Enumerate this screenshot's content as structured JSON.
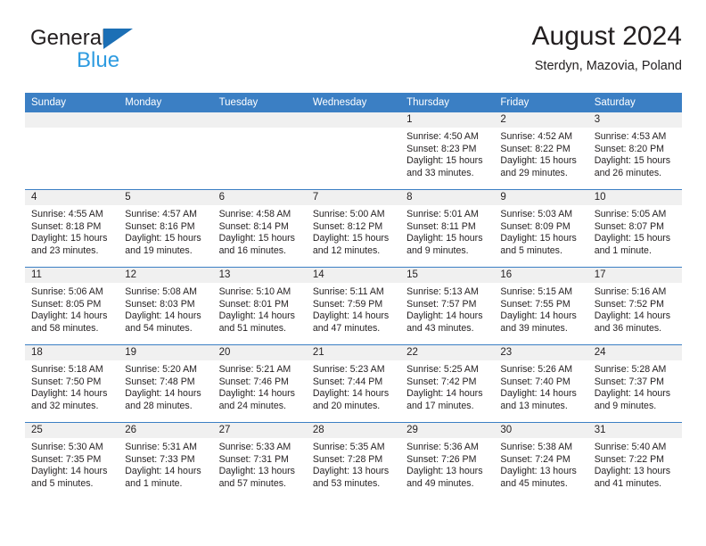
{
  "brand": {
    "name_top": "General",
    "name_bottom": "Blue",
    "triangle_color": "#1c6fb5",
    "blue_color": "#2e9be0"
  },
  "header": {
    "title": "August 2024",
    "location": "Sterdyn, Mazovia, Poland"
  },
  "colors": {
    "header_bg": "#3b7fc4",
    "header_text": "#ffffff",
    "daynum_strip": "#f0f0f0",
    "row_divider": "#3b7fc4",
    "text": "#231f20"
  },
  "weekday_headers": [
    "Sunday",
    "Monday",
    "Tuesday",
    "Wednesday",
    "Thursday",
    "Friday",
    "Saturday"
  ],
  "weeks": [
    [
      {
        "day": "",
        "info": ""
      },
      {
        "day": "",
        "info": ""
      },
      {
        "day": "",
        "info": ""
      },
      {
        "day": "",
        "info": ""
      },
      {
        "day": "1",
        "info": "Sunrise: 4:50 AM\nSunset: 8:23 PM\nDaylight: 15 hours\nand 33 minutes."
      },
      {
        "day": "2",
        "info": "Sunrise: 4:52 AM\nSunset: 8:22 PM\nDaylight: 15 hours\nand 29 minutes."
      },
      {
        "day": "3",
        "info": "Sunrise: 4:53 AM\nSunset: 8:20 PM\nDaylight: 15 hours\nand 26 minutes."
      }
    ],
    [
      {
        "day": "4",
        "info": "Sunrise: 4:55 AM\nSunset: 8:18 PM\nDaylight: 15 hours\nand 23 minutes."
      },
      {
        "day": "5",
        "info": "Sunrise: 4:57 AM\nSunset: 8:16 PM\nDaylight: 15 hours\nand 19 minutes."
      },
      {
        "day": "6",
        "info": "Sunrise: 4:58 AM\nSunset: 8:14 PM\nDaylight: 15 hours\nand 16 minutes."
      },
      {
        "day": "7",
        "info": "Sunrise: 5:00 AM\nSunset: 8:12 PM\nDaylight: 15 hours\nand 12 minutes."
      },
      {
        "day": "8",
        "info": "Sunrise: 5:01 AM\nSunset: 8:11 PM\nDaylight: 15 hours\nand 9 minutes."
      },
      {
        "day": "9",
        "info": "Sunrise: 5:03 AM\nSunset: 8:09 PM\nDaylight: 15 hours\nand 5 minutes."
      },
      {
        "day": "10",
        "info": "Sunrise: 5:05 AM\nSunset: 8:07 PM\nDaylight: 15 hours\nand 1 minute."
      }
    ],
    [
      {
        "day": "11",
        "info": "Sunrise: 5:06 AM\nSunset: 8:05 PM\nDaylight: 14 hours\nand 58 minutes."
      },
      {
        "day": "12",
        "info": "Sunrise: 5:08 AM\nSunset: 8:03 PM\nDaylight: 14 hours\nand 54 minutes."
      },
      {
        "day": "13",
        "info": "Sunrise: 5:10 AM\nSunset: 8:01 PM\nDaylight: 14 hours\nand 51 minutes."
      },
      {
        "day": "14",
        "info": "Sunrise: 5:11 AM\nSunset: 7:59 PM\nDaylight: 14 hours\nand 47 minutes."
      },
      {
        "day": "15",
        "info": "Sunrise: 5:13 AM\nSunset: 7:57 PM\nDaylight: 14 hours\nand 43 minutes."
      },
      {
        "day": "16",
        "info": "Sunrise: 5:15 AM\nSunset: 7:55 PM\nDaylight: 14 hours\nand 39 minutes."
      },
      {
        "day": "17",
        "info": "Sunrise: 5:16 AM\nSunset: 7:52 PM\nDaylight: 14 hours\nand 36 minutes."
      }
    ],
    [
      {
        "day": "18",
        "info": "Sunrise: 5:18 AM\nSunset: 7:50 PM\nDaylight: 14 hours\nand 32 minutes."
      },
      {
        "day": "19",
        "info": "Sunrise: 5:20 AM\nSunset: 7:48 PM\nDaylight: 14 hours\nand 28 minutes."
      },
      {
        "day": "20",
        "info": "Sunrise: 5:21 AM\nSunset: 7:46 PM\nDaylight: 14 hours\nand 24 minutes."
      },
      {
        "day": "21",
        "info": "Sunrise: 5:23 AM\nSunset: 7:44 PM\nDaylight: 14 hours\nand 20 minutes."
      },
      {
        "day": "22",
        "info": "Sunrise: 5:25 AM\nSunset: 7:42 PM\nDaylight: 14 hours\nand 17 minutes."
      },
      {
        "day": "23",
        "info": "Sunrise: 5:26 AM\nSunset: 7:40 PM\nDaylight: 14 hours\nand 13 minutes."
      },
      {
        "day": "24",
        "info": "Sunrise: 5:28 AM\nSunset: 7:37 PM\nDaylight: 14 hours\nand 9 minutes."
      }
    ],
    [
      {
        "day": "25",
        "info": "Sunrise: 5:30 AM\nSunset: 7:35 PM\nDaylight: 14 hours\nand 5 minutes."
      },
      {
        "day": "26",
        "info": "Sunrise: 5:31 AM\nSunset: 7:33 PM\nDaylight: 14 hours\nand 1 minute."
      },
      {
        "day": "27",
        "info": "Sunrise: 5:33 AM\nSunset: 7:31 PM\nDaylight: 13 hours\nand 57 minutes."
      },
      {
        "day": "28",
        "info": "Sunrise: 5:35 AM\nSunset: 7:28 PM\nDaylight: 13 hours\nand 53 minutes."
      },
      {
        "day": "29",
        "info": "Sunrise: 5:36 AM\nSunset: 7:26 PM\nDaylight: 13 hours\nand 49 minutes."
      },
      {
        "day": "30",
        "info": "Sunrise: 5:38 AM\nSunset: 7:24 PM\nDaylight: 13 hours\nand 45 minutes."
      },
      {
        "day": "31",
        "info": "Sunrise: 5:40 AM\nSunset: 7:22 PM\nDaylight: 13 hours\nand 41 minutes."
      }
    ]
  ]
}
